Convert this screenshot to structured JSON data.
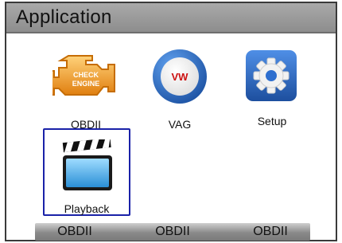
{
  "window": {
    "title": "Application"
  },
  "apps": [
    {
      "label": "OBDII",
      "icon": "check-engine-icon",
      "icon_text": [
        "CHECK",
        "ENGINE"
      ]
    },
    {
      "label": "VAG",
      "icon": "vw-logo-icon",
      "icon_text": [
        "VW"
      ]
    },
    {
      "label": "Setup",
      "icon": "gear-icon"
    },
    {
      "label": "Playback",
      "icon": "clapperboard-icon",
      "selected": true
    }
  ],
  "softkeys": [
    "OBDII",
    "OBDII",
    "OBDII"
  ],
  "colors": {
    "titlebar": "#999999",
    "selection_border": "#1a22a8",
    "engine_orange": "#f29a1e",
    "vw_blue": "#1f5fb8",
    "gear_blue": "#2e6fcf"
  }
}
